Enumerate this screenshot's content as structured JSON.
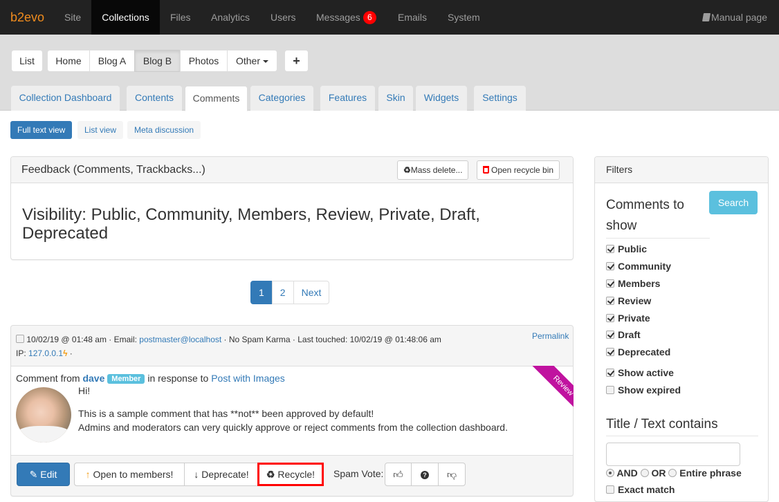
{
  "topnav": {
    "brand": "b2evo",
    "items": [
      {
        "label": "Site"
      },
      {
        "label": "Collections",
        "active": true
      },
      {
        "label": "Files"
      },
      {
        "label": "Analytics"
      },
      {
        "label": "Users"
      },
      {
        "label": "Messages",
        "badge": "6"
      },
      {
        "label": "Emails"
      },
      {
        "label": "System"
      }
    ],
    "manual": "Manual page",
    "manual_icon": "book-icon"
  },
  "collections": {
    "list_label": "List",
    "items": [
      "Home",
      "Blog A",
      "Blog B",
      "Photos",
      "Other"
    ],
    "selected": "Blog B",
    "add_label": "+"
  },
  "tabs": [
    "Collection Dashboard",
    "Contents",
    "Comments",
    "Categories",
    "Features",
    "Skin",
    "Widgets",
    "Settings"
  ],
  "active_tab": "Comments",
  "views": [
    "Full text view",
    "List view",
    "Meta discussion"
  ],
  "active_view": "Full text view",
  "feedback_panel": {
    "title": "Feedback (Comments, Trackbacks...)",
    "mass_delete": "Mass delete...",
    "open_recycle_bin": "Open recycle bin",
    "visibility_text": "Visibility: Public, Community, Members, Review, Private, Draft, Deprecated"
  },
  "pagination": {
    "pages": [
      "1",
      "2"
    ],
    "current": "1",
    "next": "Next"
  },
  "comment": {
    "date": "10/02/19 @ 01:48 am",
    "email_label": "· Email:",
    "email": "postmaster@localhost",
    "karma": "· No Spam Karma · Last touched: 10/02/19 @ 01:48:06 am",
    "ip_label": "IP:",
    "ip": "127.0.0.1",
    "ip_suffix": "·",
    "permalink": "Permalink",
    "from_label": "Comment from",
    "author": "dave",
    "author_badge": "Member",
    "response_label": "in response to",
    "post_title": "Post with Images",
    "greeting": "Hi!",
    "body_line1": "This is a sample comment that has **not** been approved by default!",
    "body_line2": "Admins and moderators can very quickly approve or reject comments from the collection dashboard.",
    "status_ribbon": "Review",
    "status_color": "#c0129f"
  },
  "actions": {
    "edit": "Edit",
    "open_to_members": "Open to members!",
    "deprecate": "Deprecate!",
    "recycle": "Recycle!",
    "spam_vote_label": "Spam Vote:"
  },
  "filters": {
    "title": "Filters",
    "search_button": "Search",
    "comments_heading": "Comments to show",
    "statuses": [
      {
        "label": "Public",
        "checked": true
      },
      {
        "label": "Community",
        "checked": true
      },
      {
        "label": "Members",
        "checked": true
      },
      {
        "label": "Review",
        "checked": true
      },
      {
        "label": "Private",
        "checked": true
      },
      {
        "label": "Draft",
        "checked": true
      },
      {
        "label": "Deprecated",
        "checked": true
      }
    ],
    "show_active": {
      "label": "Show active",
      "checked": true
    },
    "show_expired": {
      "label": "Show expired",
      "checked": false
    },
    "text_heading": "Title / Text contains",
    "text_value": "",
    "match_modes": [
      "AND",
      "OR",
      "Entire phrase"
    ],
    "match_selected": "AND",
    "exact_match": {
      "label": "Exact match",
      "checked": false
    }
  },
  "colors": {
    "primary": "#337ab7",
    "brand": "#f08c1e",
    "info": "#5bc0de",
    "danger": "#ff0000"
  }
}
